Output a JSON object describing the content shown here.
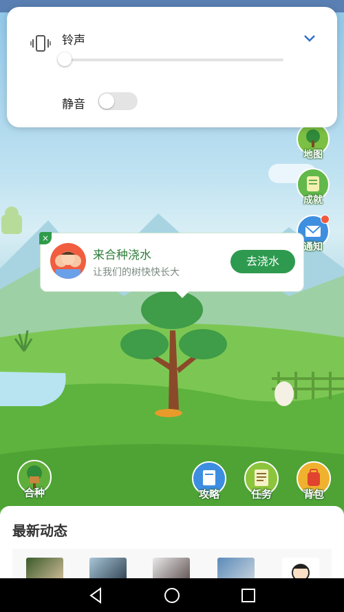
{
  "volume_panel": {
    "ringtone_label": "铃声",
    "ringtone_level": 0,
    "mute_label": "静音",
    "mute_on": false
  },
  "side_buttons": [
    {
      "label": "地图",
      "icon": "map-tree-icon"
    },
    {
      "label": "成就",
      "icon": "achievement-icon"
    },
    {
      "label": "通知",
      "icon": "notification-mail-icon"
    }
  ],
  "popup": {
    "title": "来合种浇水",
    "subtitle": "让我们的树快快长大",
    "action_label": "去浇水",
    "close_glyph": "×"
  },
  "bottom_buttons": [
    {
      "label": "合种",
      "icon": "treehouse-icon"
    },
    {
      "label": "攻略",
      "icon": "guide-book-icon"
    },
    {
      "label": "任务",
      "icon": "task-list-icon"
    },
    {
      "label": "背包",
      "icon": "backpack-icon"
    }
  ],
  "feed": {
    "heading": "最新动态"
  },
  "colors": {
    "accent_green": "#2e9a4f",
    "popup_title": "#2f7d3a",
    "status_bar": "#5a7fb2"
  }
}
